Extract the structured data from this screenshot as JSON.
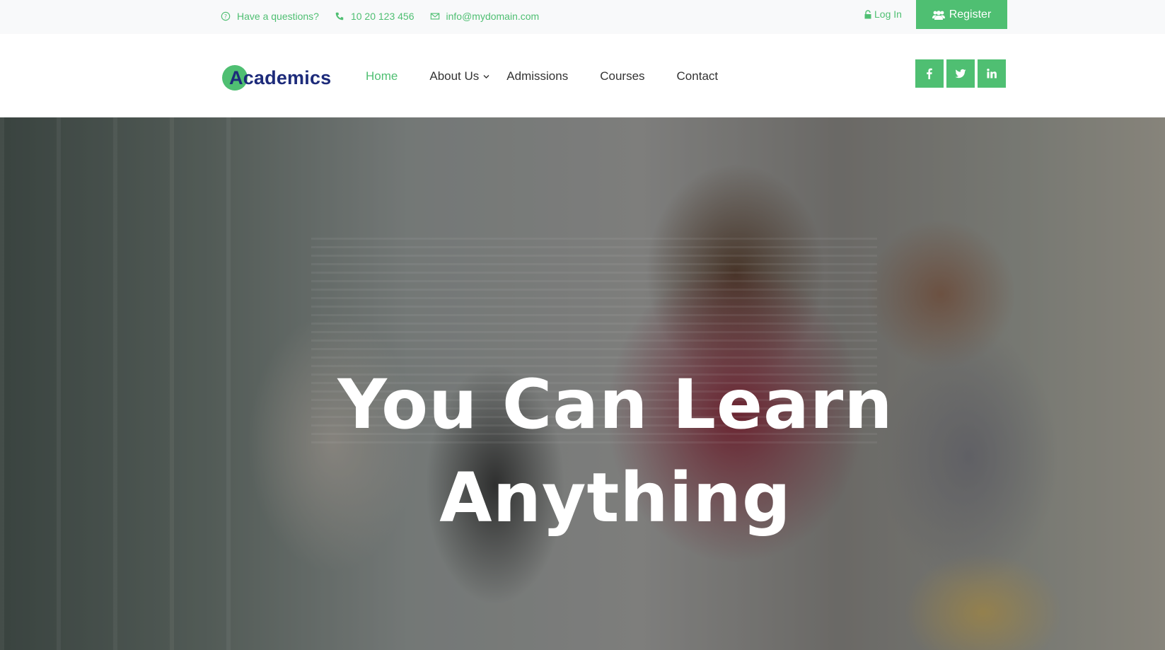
{
  "topbar": {
    "question": "Have a questions?",
    "phone": "10 20 123 456",
    "email": "info@mydomain.com",
    "login_label": "Log In",
    "register_label": "Register"
  },
  "logo": {
    "text": "Academics"
  },
  "nav": {
    "items": [
      {
        "label": "Home",
        "active": true
      },
      {
        "label": "About Us",
        "has_dropdown": true
      },
      {
        "label": "Admissions"
      },
      {
        "label": "Courses"
      },
      {
        "label": "Contact"
      }
    ]
  },
  "social": {
    "icons": [
      "facebook-icon",
      "twitter-icon",
      "linkedin-icon"
    ]
  },
  "hero": {
    "line1": "You Can Learn",
    "line2": "Anything"
  },
  "colors": {
    "accent": "#4fbf72",
    "logo_text": "#1d2b7a",
    "topbar_bg": "#f8f9fa"
  }
}
